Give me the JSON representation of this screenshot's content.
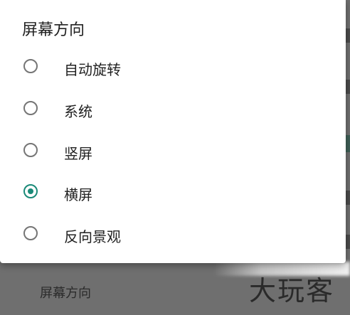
{
  "background": {
    "setting_label": "屏幕方向",
    "watermark_text": "大玩客"
  },
  "dialog": {
    "title": "屏幕方向",
    "options": [
      {
        "label": "自动旋转",
        "selected": false
      },
      {
        "label": "系统",
        "selected": false
      },
      {
        "label": "竖屏",
        "selected": false
      },
      {
        "label": "横屏",
        "selected": true
      },
      {
        "label": "反向景观",
        "selected": false
      }
    ]
  },
  "colors": {
    "accent": "#1a8a78",
    "radio_unchecked": "#757575",
    "dialog_bg": "#ffffff",
    "scrim": "#6f6f6f"
  }
}
